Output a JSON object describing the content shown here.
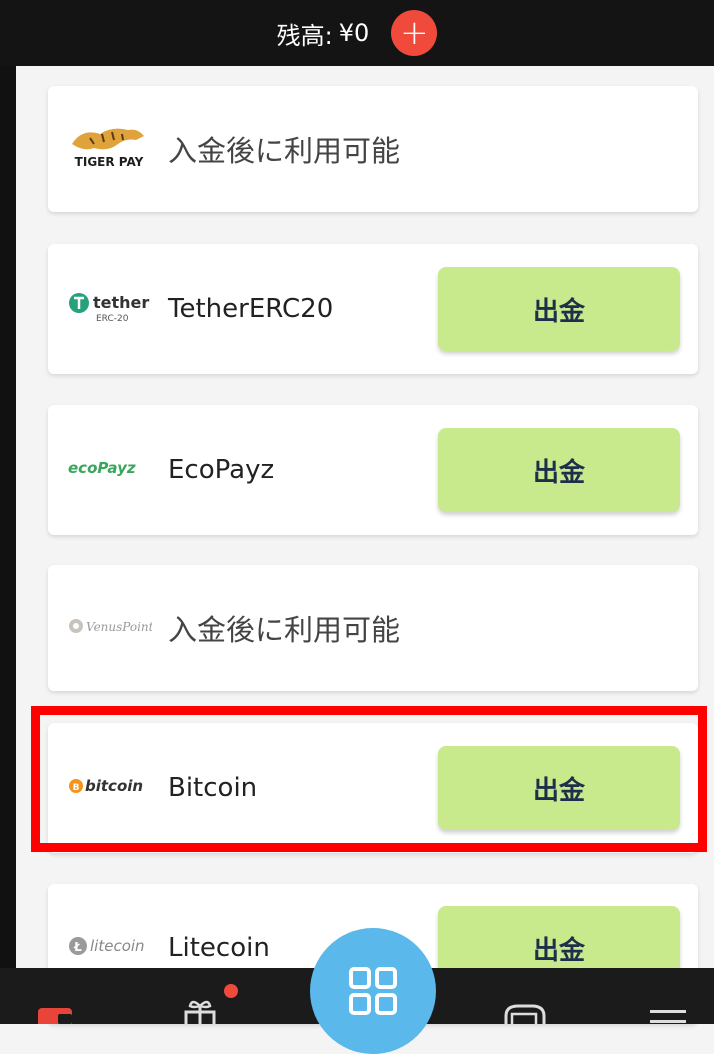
{
  "header": {
    "balance_label": "残高:",
    "balance_value": "¥0"
  },
  "methods": [
    {
      "logo_text": "TIGER PAY",
      "name": "入金後に利用可能",
      "available": false
    },
    {
      "logo_text": "tether",
      "logo_sub": "ERC-20",
      "name": "TetherERC20",
      "button": "出金",
      "available": true
    },
    {
      "logo_text": "ecoPayz",
      "name": "EcoPayz",
      "button": "出金",
      "available": true
    },
    {
      "logo_text": "VenusPoint",
      "name": "入金後に利用可能",
      "available": false
    },
    {
      "logo_text": "bitcoin",
      "name": "Bitcoin",
      "button": "出金",
      "available": true,
      "highlighted": true
    },
    {
      "logo_text": "litecoin",
      "name": "Litecoin",
      "button": "出金",
      "available": true
    }
  ],
  "colors": {
    "accent_red": "#f04a3d",
    "button_green": "#c8ea8c",
    "button_text": "#1d2f4a",
    "center_button": "#5ab8ea",
    "highlight": "#ff0000"
  },
  "icons": [
    "plus-icon",
    "wallet-icon",
    "gift-icon",
    "grid-icon",
    "slot-machine-icon",
    "menu-icon"
  ]
}
